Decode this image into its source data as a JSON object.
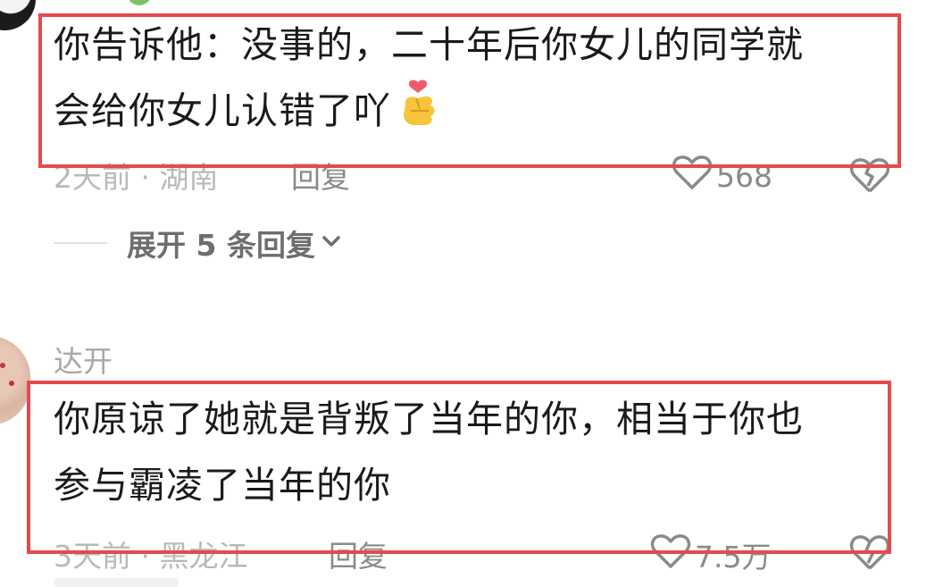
{
  "comments": [
    {
      "text": "你告诉他：没事的，二十年后你女儿的同学就\n会给你女儿认错了吖",
      "emoji_icon": "finger-heart-icon",
      "time_location": "2天前 · 湖南",
      "reply_label": "回复",
      "like_count": "568",
      "expand_label": "展开 5 条回复",
      "expand_icon": "chevron-down-icon"
    },
    {
      "username": "达开",
      "text": "你原谅了她就是背叛了当年的你，相当于你也\n参与霸凌了当年的你",
      "time_location": "3天前 · 黑龙江",
      "reply_label": "回复",
      "like_count": "7.5万"
    }
  ],
  "colors": {
    "highlight_border": "#e64a4e",
    "text": "#1a1a1a",
    "meta": "#b9b9b9",
    "action": "#8a8a8a"
  }
}
